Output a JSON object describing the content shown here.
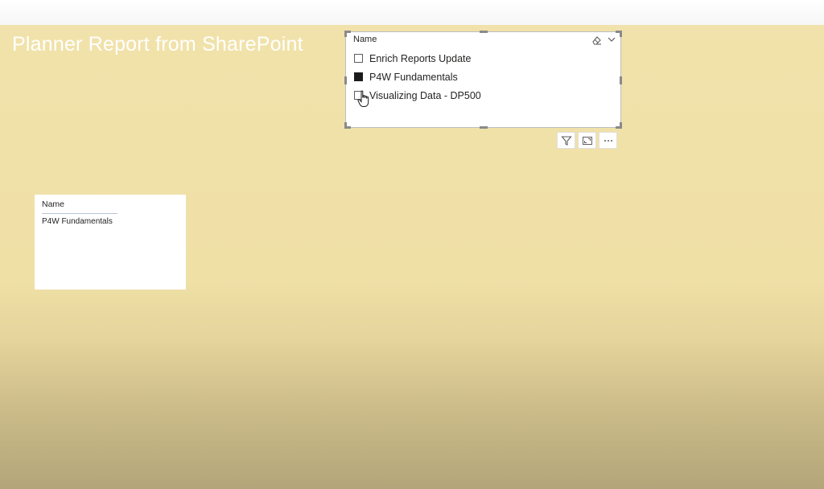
{
  "report": {
    "title": "Planner Report from SharePoint"
  },
  "slicer": {
    "header": "Name",
    "items": [
      {
        "label": "Enrich Reports Update",
        "checked": false
      },
      {
        "label": "P4W Fundamentals",
        "checked": true
      },
      {
        "label": "Visualizing Data - DP500",
        "checked": false
      }
    ],
    "icons": {
      "clear": "eraser-icon",
      "expand": "chevron-down-icon"
    }
  },
  "visual_toolbar": {
    "buttons": [
      "filter-icon",
      "focus-mode-icon",
      "more-options-icon"
    ]
  },
  "table": {
    "header": "Name",
    "rows": [
      "P4W Fundamentals"
    ]
  },
  "colors": {
    "canvas_background": "#f1e2ab",
    "title_text": "#ffffff",
    "checked_box": "#1b1b1b"
  }
}
